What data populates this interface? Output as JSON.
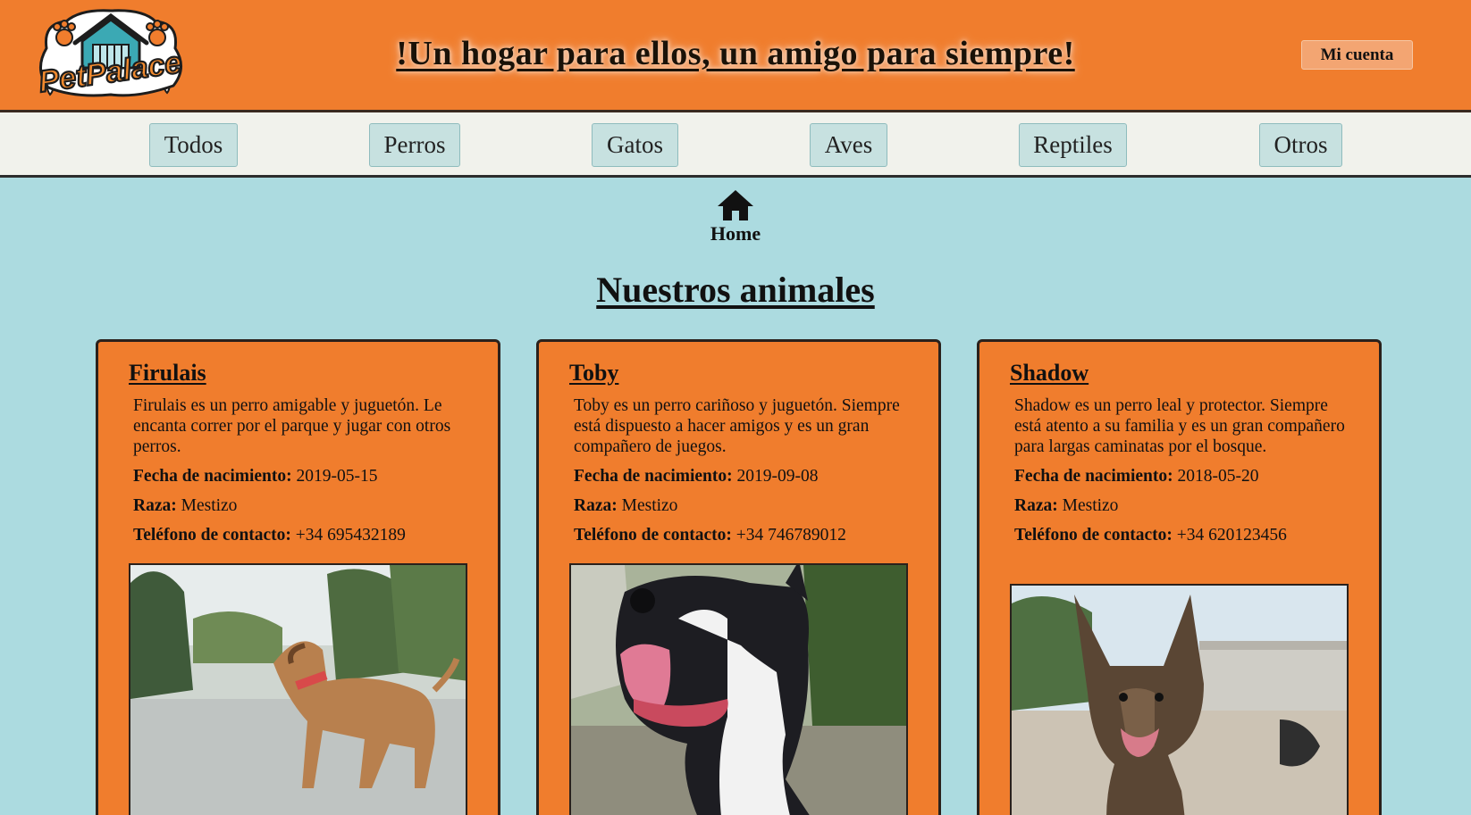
{
  "header": {
    "logo_text": "PetPalace",
    "slogan": "!Un hogar para ellos, un amigo para siempre!",
    "account_button": "Mi cuenta"
  },
  "categories": [
    {
      "label": "Todos"
    },
    {
      "label": "Perros"
    },
    {
      "label": "Gatos"
    },
    {
      "label": "Aves"
    },
    {
      "label": "Reptiles"
    },
    {
      "label": "Otros"
    }
  ],
  "home": {
    "icon": "home-icon",
    "label": "Home"
  },
  "section_title": "Nuestros animales",
  "labels": {
    "birth": "Fecha de nacimiento:",
    "breed": "Raza:",
    "phone": "Teléfono de contacto:"
  },
  "animals": [
    {
      "name": "Firulais",
      "description": "Firulais es un perro amigable y juguetón. Le encanta correr por el parque y jugar con otros perros.",
      "birth_date": "2019-05-15",
      "breed": "Mestizo",
      "phone": "+34 695432189"
    },
    {
      "name": "Toby",
      "description": "Toby es un perro cariñoso y juguetón. Siempre está dispuesto a hacer amigos y es un gran compañero de juegos.",
      "birth_date": "2019-09-08",
      "breed": "Mestizo",
      "phone": "+34 746789012"
    },
    {
      "name": "Shadow",
      "description": "Shadow es un perro leal y protector. Siempre está atento a su familia y es un gran compañero para largas caminatas por el bosque.",
      "birth_date": "2018-05-20",
      "breed": "Mestizo",
      "phone": "+34 620123456"
    }
  ],
  "colors": {
    "header_orange": "#f07d2d",
    "page_bg": "#acdbe0",
    "nav_bg": "#f1f2ec",
    "category_button": "#c7e1e0"
  }
}
